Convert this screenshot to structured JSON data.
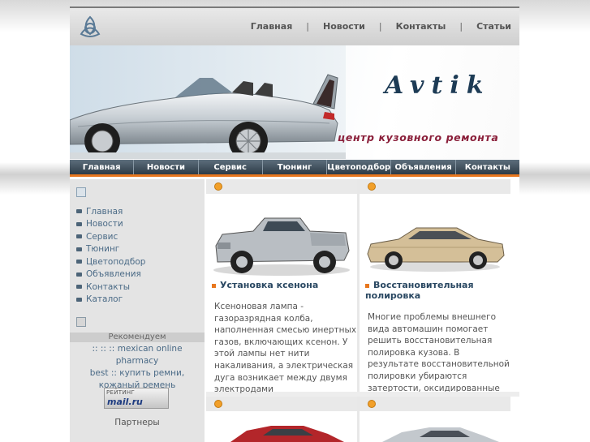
{
  "top_nav": {
    "items": [
      "Главная",
      "Новости",
      "Контакты",
      "Статьи"
    ],
    "separator": "|"
  },
  "banner": {
    "brand": "Avtik",
    "tagline": "центр кузовного ремонта"
  },
  "main_nav": {
    "items": [
      "Главная",
      "Новости",
      "Сервис",
      "Тюнинг",
      "Цветоподбор",
      "Объявления",
      "Контакты"
    ]
  },
  "sidebar": {
    "menu": [
      "Главная",
      "Новости",
      "Сервис",
      "Тюнинг",
      "Цветоподбор",
      "Объявления",
      "Контакты",
      "Каталог"
    ],
    "recommend_title": "Рекомендуем",
    "recommend_prefix": ":: :: ::",
    "recommend_link1": "mexican online pharmacy",
    "recommend_link2": "best",
    "recommend_mid": "::",
    "recommend_link3": "купить ремни, кожаный ремень",
    "rating_label": "РЕЙТИНГ",
    "rating_brand": "mail.ru",
    "partners": "Партнеры"
  },
  "cards": [
    {
      "title": "Установка ксенона",
      "text": "Ксеноновая лампа - газоразрядная колба, наполненная смесью инертных газов, включающих ксенон. У этой лампы нет нити накаливания, а электрическая дуга возникает между двумя электродами"
    },
    {
      "title": "Восстановительная полировка",
      "text": "Многие проблемы внешнего вида автомашин помогает решить восстановительная полировка кузова. В результате восстановительной полировки убираются затертости, оксидированные слои краски, поверхностные царапины"
    }
  ],
  "colors": {
    "accent": "#e8771e",
    "nav_dark": "#3b4a57",
    "link": "#4a6a86",
    "brand": "#1d3b55",
    "tagline": "#8a1f3a"
  }
}
